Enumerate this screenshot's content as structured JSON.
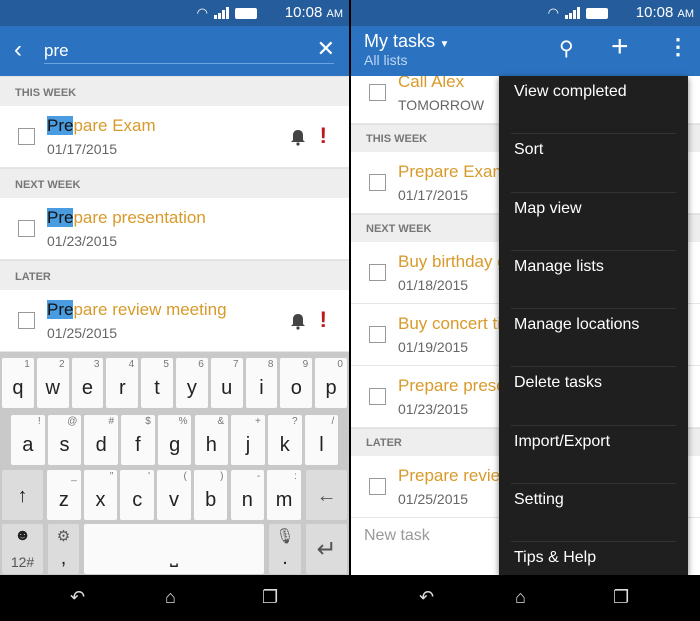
{
  "status": {
    "time": "10:08",
    "ampm": "AM"
  },
  "left": {
    "search": {
      "query": "pre"
    },
    "groups": [
      {
        "header": "THIS WEEK",
        "task": {
          "match": "Pre",
          "rest": "pare Exam",
          "date": "01/17/2015",
          "reminder": true,
          "priority": "!"
        }
      },
      {
        "header": "NEXT WEEK",
        "task": {
          "match": "Pre",
          "rest": "pare presentation",
          "date": "01/23/2015",
          "reminder": false,
          "priority": ""
        }
      },
      {
        "header": "LATER",
        "task": {
          "match": "Pre",
          "rest": "pare review meeting",
          "date": "01/25/2015",
          "reminder": true,
          "priority": "!"
        }
      }
    ],
    "keyboard": {
      "row1": [
        [
          "q",
          "1"
        ],
        [
          "w",
          "2"
        ],
        [
          "e",
          "3"
        ],
        [
          "r",
          "4"
        ],
        [
          "t",
          "5"
        ],
        [
          "y",
          "6"
        ],
        [
          "u",
          "7"
        ],
        [
          "i",
          "8"
        ],
        [
          "o",
          "9"
        ],
        [
          "p",
          "0"
        ]
      ],
      "row2": [
        [
          "a",
          "!"
        ],
        [
          "s",
          "@"
        ],
        [
          "d",
          "#"
        ],
        [
          "f",
          "$"
        ],
        [
          "g",
          "%"
        ],
        [
          "h",
          "&"
        ],
        [
          "j",
          "+"
        ],
        [
          "k",
          "?"
        ],
        [
          "l",
          "/"
        ]
      ],
      "row3": [
        [
          "z",
          "_"
        ],
        [
          "x",
          "\""
        ],
        [
          "c",
          "'"
        ],
        [
          "v",
          "("
        ],
        [
          "b",
          ")"
        ],
        [
          "n",
          "-"
        ],
        [
          "m",
          ":"
        ]
      ],
      "symbols_label": "12#",
      "comma": ",",
      "period": "."
    }
  },
  "right": {
    "title": "My tasks",
    "subtitle": "All lists",
    "items": [
      {
        "kind": "task",
        "title": "Call Alex",
        "date": "TOMORROW"
      },
      {
        "kind": "header",
        "label": "THIS WEEK"
      },
      {
        "kind": "task",
        "title": "Prepare Exam",
        "date": "01/17/2015"
      },
      {
        "kind": "header",
        "label": "NEXT WEEK"
      },
      {
        "kind": "task",
        "title": "Buy birthday g",
        "date": "01/18/2015"
      },
      {
        "kind": "task",
        "title": "Buy concert ti",
        "date": "01/19/2015"
      },
      {
        "kind": "task",
        "title": "Prepare prese",
        "date": "01/23/2015"
      },
      {
        "kind": "header",
        "label": "LATER"
      },
      {
        "kind": "task",
        "title": "Prepare review",
        "date": "01/25/2015"
      }
    ],
    "new_task_placeholder": "New task",
    "menu": [
      "View completed",
      "Sort",
      "Map view",
      "Manage lists",
      "Manage locations",
      "Delete tasks",
      "Import/Export",
      "Setting",
      "Tips & Help"
    ]
  },
  "colors": {
    "appbar": "#2b73c0",
    "statusbar": "#245c9c",
    "task_title": "#d89a2a",
    "highlight": "#4a9ce0",
    "priority": "#c0171f",
    "menu": "#1f1f1f"
  }
}
